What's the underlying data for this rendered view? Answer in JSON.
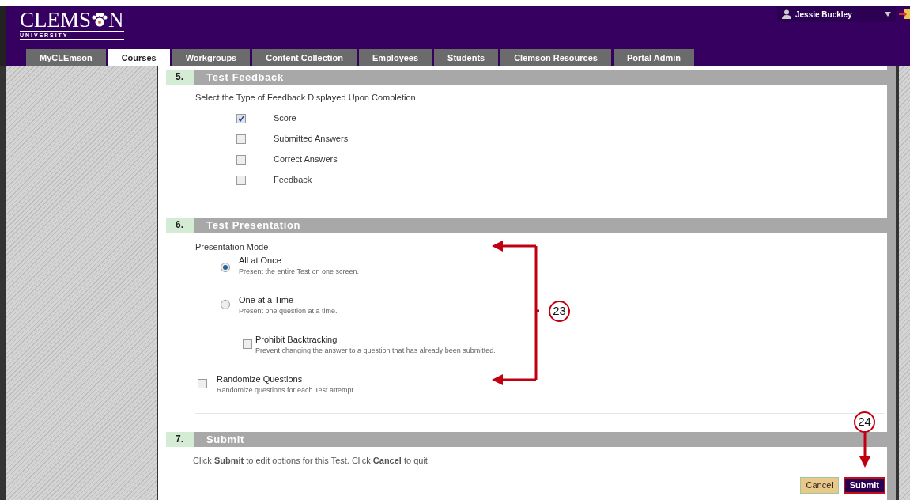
{
  "header": {
    "logo": {
      "text_before": "CLEMS",
      "text_after": "N",
      "subtitle": "U N I V E R S I T Y"
    },
    "user": {
      "name": "Jessie Buckley"
    }
  },
  "tabs": [
    {
      "label": "MyCLEmson",
      "selected": false
    },
    {
      "label": "Courses",
      "selected": true
    },
    {
      "label": "Workgroups",
      "selected": false
    },
    {
      "label": "Content Collection",
      "selected": false
    },
    {
      "label": "Employees",
      "selected": false
    },
    {
      "label": "Students",
      "selected": false
    },
    {
      "label": "Clemson Resources",
      "selected": false
    },
    {
      "label": "Portal Admin",
      "selected": false
    }
  ],
  "feedback_section": {
    "number": "5.",
    "title": "Test Feedback",
    "prompt": "Select the Type of Feedback Displayed Upon Completion",
    "options": [
      {
        "label": "Score",
        "checked": true
      },
      {
        "label": "Submitted Answers",
        "checked": false
      },
      {
        "label": "Correct Answers",
        "checked": false
      },
      {
        "label": "Feedback",
        "checked": false
      }
    ]
  },
  "presentation_section": {
    "number": "6.",
    "title": "Test Presentation",
    "prompt": "Presentation Mode",
    "modes": [
      {
        "label": "All at Once",
        "description": "Present the entire Test on one screen.",
        "selected": true
      },
      {
        "label": "One at a Time",
        "description": "Present one question at a time.",
        "selected": false
      }
    ],
    "prohibit_backtracking": {
      "label": "Prohibit Backtracking",
      "description": "Prevent changing the answer to a question that has already been submitted.",
      "checked": false
    },
    "randomize": {
      "label": "Randomize Questions",
      "description": "Randomize questions for each Test attempt.",
      "checked": false
    }
  },
  "submit_section": {
    "number": "7.",
    "title": "Submit",
    "instructions": "Click **Submit** to edit options for this Test. Click **Cancel** to quit.",
    "buttons": [
      {
        "label": "Cancel",
        "kind": "cancel"
      },
      {
        "label": "Submit",
        "kind": "submit"
      }
    ]
  },
  "annotations": [
    {
      "label": "23"
    },
    {
      "label": "24"
    }
  ]
}
